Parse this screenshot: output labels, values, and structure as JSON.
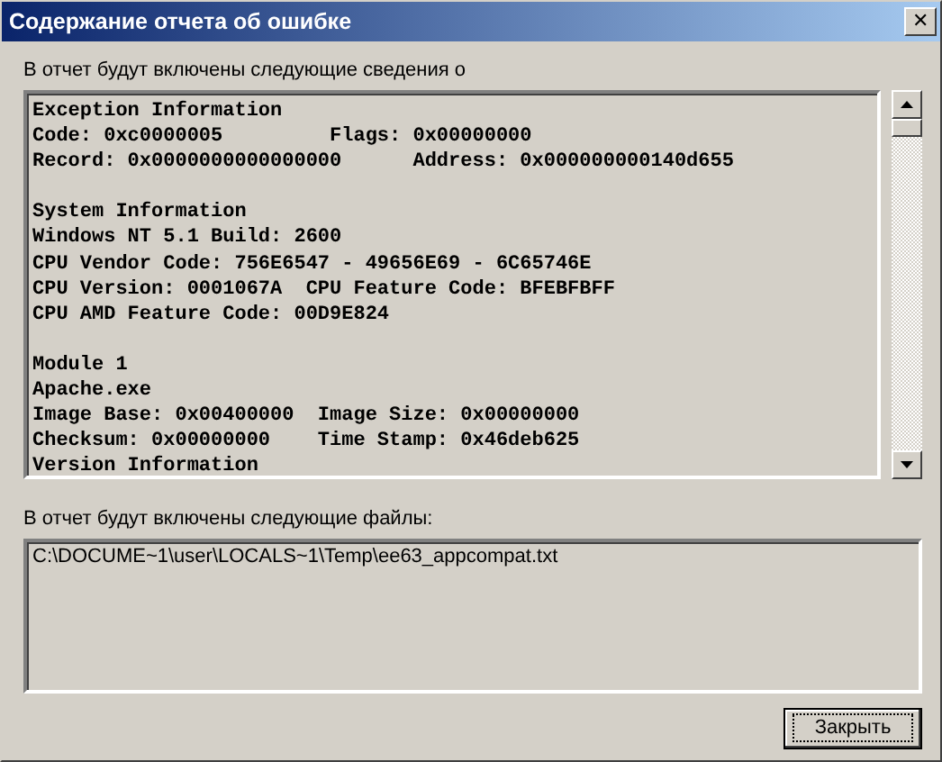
{
  "window": {
    "title": "Содержание отчета об ошибке",
    "close": "✕"
  },
  "report": {
    "label": "В отчет будут включены следующие сведения о",
    "sections": [
      {
        "lines": [
          "Exception Information",
          "Code: 0xc0000005         Flags: 0x00000000",
          "Record: 0x0000000000000000      Address: 0x000000000140d655"
        ]
      },
      {
        "lines": [
          "System Information",
          "Windows NT 5.1 Build: 2600",
          "CPU Vendor Code: 756E6547 - 49656E69 - 6C65746E",
          "CPU Version: 0001067A  CPU Feature Code: BFEBFBFF",
          "CPU AMD Feature Code: 00D9E824"
        ]
      },
      {
        "lines": [
          "Module 1",
          "Apache.exe",
          "Image Base: 0x00400000  Image Size: 0x00000000",
          "Checksum: 0x00000000    Time Stamp: 0x46deb625",
          "Version Information"
        ]
      }
    ]
  },
  "files": {
    "label": "В отчет будут включены следующие файлы:",
    "items": [
      "C:\\DOCUME~1\\user\\LOCALS~1\\Temp\\ee63_appcompat.txt"
    ]
  },
  "buttons": [
    {
      "label": "Закрыть",
      "focused": true
    }
  ]
}
